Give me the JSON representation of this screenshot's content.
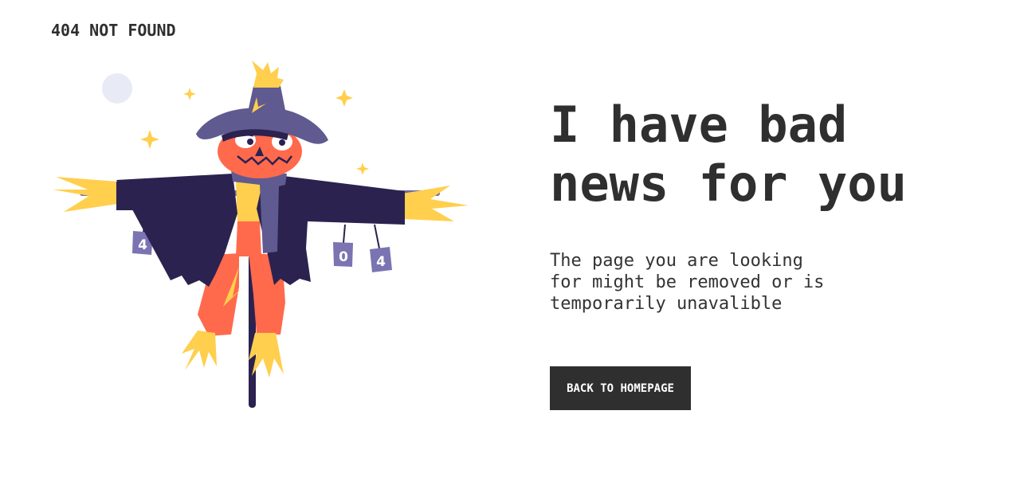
{
  "header": {
    "brand": "404 NOT FOUND"
  },
  "illustration": {
    "can_labels": [
      "4",
      "0",
      "4"
    ]
  },
  "main": {
    "headline_line1": "I have bad",
    "headline_line2": "news for you",
    "message_line1": "The page you are looking",
    "message_line2": "for might be removed or is",
    "message_line3": "temporarily unavalible",
    "button_label": "BACK TO HOMEPAGE"
  },
  "colors": {
    "text_dark": "#2f2f2f",
    "button_bg": "#2f2f2f",
    "button_text": "#ffffff",
    "hat_purple": "#5f5a8f",
    "coat_navy": "#2b2250",
    "pumpkin_orange": "#ff6a4d",
    "straw_yellow": "#ffcf4d",
    "moon_lavender": "#e8eaf6"
  }
}
